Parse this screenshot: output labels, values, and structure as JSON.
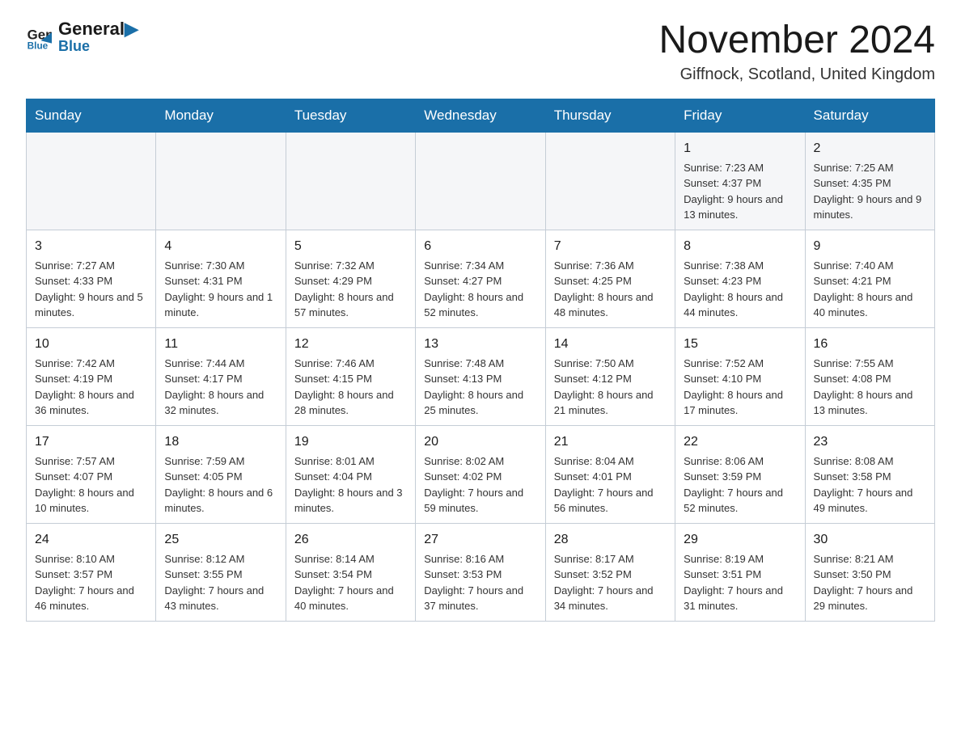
{
  "logo": {
    "text_black": "General",
    "text_blue": "Blue",
    "triangle_color": "#1a6fa8"
  },
  "header": {
    "month_year": "November 2024",
    "location": "Giffnock, Scotland, United Kingdom"
  },
  "days_of_week": [
    "Sunday",
    "Monday",
    "Tuesday",
    "Wednesday",
    "Thursday",
    "Friday",
    "Saturday"
  ],
  "weeks": [
    [
      {
        "day": "",
        "sunrise": "",
        "sunset": "",
        "daylight": ""
      },
      {
        "day": "",
        "sunrise": "",
        "sunset": "",
        "daylight": ""
      },
      {
        "day": "",
        "sunrise": "",
        "sunset": "",
        "daylight": ""
      },
      {
        "day": "",
        "sunrise": "",
        "sunset": "",
        "daylight": ""
      },
      {
        "day": "",
        "sunrise": "",
        "sunset": "",
        "daylight": ""
      },
      {
        "day": "1",
        "sunrise": "Sunrise: 7:23 AM",
        "sunset": "Sunset: 4:37 PM",
        "daylight": "Daylight: 9 hours and 13 minutes."
      },
      {
        "day": "2",
        "sunrise": "Sunrise: 7:25 AM",
        "sunset": "Sunset: 4:35 PM",
        "daylight": "Daylight: 9 hours and 9 minutes."
      }
    ],
    [
      {
        "day": "3",
        "sunrise": "Sunrise: 7:27 AM",
        "sunset": "Sunset: 4:33 PM",
        "daylight": "Daylight: 9 hours and 5 minutes."
      },
      {
        "day": "4",
        "sunrise": "Sunrise: 7:30 AM",
        "sunset": "Sunset: 4:31 PM",
        "daylight": "Daylight: 9 hours and 1 minute."
      },
      {
        "day": "5",
        "sunrise": "Sunrise: 7:32 AM",
        "sunset": "Sunset: 4:29 PM",
        "daylight": "Daylight: 8 hours and 57 minutes."
      },
      {
        "day": "6",
        "sunrise": "Sunrise: 7:34 AM",
        "sunset": "Sunset: 4:27 PM",
        "daylight": "Daylight: 8 hours and 52 minutes."
      },
      {
        "day": "7",
        "sunrise": "Sunrise: 7:36 AM",
        "sunset": "Sunset: 4:25 PM",
        "daylight": "Daylight: 8 hours and 48 minutes."
      },
      {
        "day": "8",
        "sunrise": "Sunrise: 7:38 AM",
        "sunset": "Sunset: 4:23 PM",
        "daylight": "Daylight: 8 hours and 44 minutes."
      },
      {
        "day": "9",
        "sunrise": "Sunrise: 7:40 AM",
        "sunset": "Sunset: 4:21 PM",
        "daylight": "Daylight: 8 hours and 40 minutes."
      }
    ],
    [
      {
        "day": "10",
        "sunrise": "Sunrise: 7:42 AM",
        "sunset": "Sunset: 4:19 PM",
        "daylight": "Daylight: 8 hours and 36 minutes."
      },
      {
        "day": "11",
        "sunrise": "Sunrise: 7:44 AM",
        "sunset": "Sunset: 4:17 PM",
        "daylight": "Daylight: 8 hours and 32 minutes."
      },
      {
        "day": "12",
        "sunrise": "Sunrise: 7:46 AM",
        "sunset": "Sunset: 4:15 PM",
        "daylight": "Daylight: 8 hours and 28 minutes."
      },
      {
        "day": "13",
        "sunrise": "Sunrise: 7:48 AM",
        "sunset": "Sunset: 4:13 PM",
        "daylight": "Daylight: 8 hours and 25 minutes."
      },
      {
        "day": "14",
        "sunrise": "Sunrise: 7:50 AM",
        "sunset": "Sunset: 4:12 PM",
        "daylight": "Daylight: 8 hours and 21 minutes."
      },
      {
        "day": "15",
        "sunrise": "Sunrise: 7:52 AM",
        "sunset": "Sunset: 4:10 PM",
        "daylight": "Daylight: 8 hours and 17 minutes."
      },
      {
        "day": "16",
        "sunrise": "Sunrise: 7:55 AM",
        "sunset": "Sunset: 4:08 PM",
        "daylight": "Daylight: 8 hours and 13 minutes."
      }
    ],
    [
      {
        "day": "17",
        "sunrise": "Sunrise: 7:57 AM",
        "sunset": "Sunset: 4:07 PM",
        "daylight": "Daylight: 8 hours and 10 minutes."
      },
      {
        "day": "18",
        "sunrise": "Sunrise: 7:59 AM",
        "sunset": "Sunset: 4:05 PM",
        "daylight": "Daylight: 8 hours and 6 minutes."
      },
      {
        "day": "19",
        "sunrise": "Sunrise: 8:01 AM",
        "sunset": "Sunset: 4:04 PM",
        "daylight": "Daylight: 8 hours and 3 minutes."
      },
      {
        "day": "20",
        "sunrise": "Sunrise: 8:02 AM",
        "sunset": "Sunset: 4:02 PM",
        "daylight": "Daylight: 7 hours and 59 minutes."
      },
      {
        "day": "21",
        "sunrise": "Sunrise: 8:04 AM",
        "sunset": "Sunset: 4:01 PM",
        "daylight": "Daylight: 7 hours and 56 minutes."
      },
      {
        "day": "22",
        "sunrise": "Sunrise: 8:06 AM",
        "sunset": "Sunset: 3:59 PM",
        "daylight": "Daylight: 7 hours and 52 minutes."
      },
      {
        "day": "23",
        "sunrise": "Sunrise: 8:08 AM",
        "sunset": "Sunset: 3:58 PM",
        "daylight": "Daylight: 7 hours and 49 minutes."
      }
    ],
    [
      {
        "day": "24",
        "sunrise": "Sunrise: 8:10 AM",
        "sunset": "Sunset: 3:57 PM",
        "daylight": "Daylight: 7 hours and 46 minutes."
      },
      {
        "day": "25",
        "sunrise": "Sunrise: 8:12 AM",
        "sunset": "Sunset: 3:55 PM",
        "daylight": "Daylight: 7 hours and 43 minutes."
      },
      {
        "day": "26",
        "sunrise": "Sunrise: 8:14 AM",
        "sunset": "Sunset: 3:54 PM",
        "daylight": "Daylight: 7 hours and 40 minutes."
      },
      {
        "day": "27",
        "sunrise": "Sunrise: 8:16 AM",
        "sunset": "Sunset: 3:53 PM",
        "daylight": "Daylight: 7 hours and 37 minutes."
      },
      {
        "day": "28",
        "sunrise": "Sunrise: 8:17 AM",
        "sunset": "Sunset: 3:52 PM",
        "daylight": "Daylight: 7 hours and 34 minutes."
      },
      {
        "day": "29",
        "sunrise": "Sunrise: 8:19 AM",
        "sunset": "Sunset: 3:51 PM",
        "daylight": "Daylight: 7 hours and 31 minutes."
      },
      {
        "day": "30",
        "sunrise": "Sunrise: 8:21 AM",
        "sunset": "Sunset: 3:50 PM",
        "daylight": "Daylight: 7 hours and 29 minutes."
      }
    ]
  ]
}
